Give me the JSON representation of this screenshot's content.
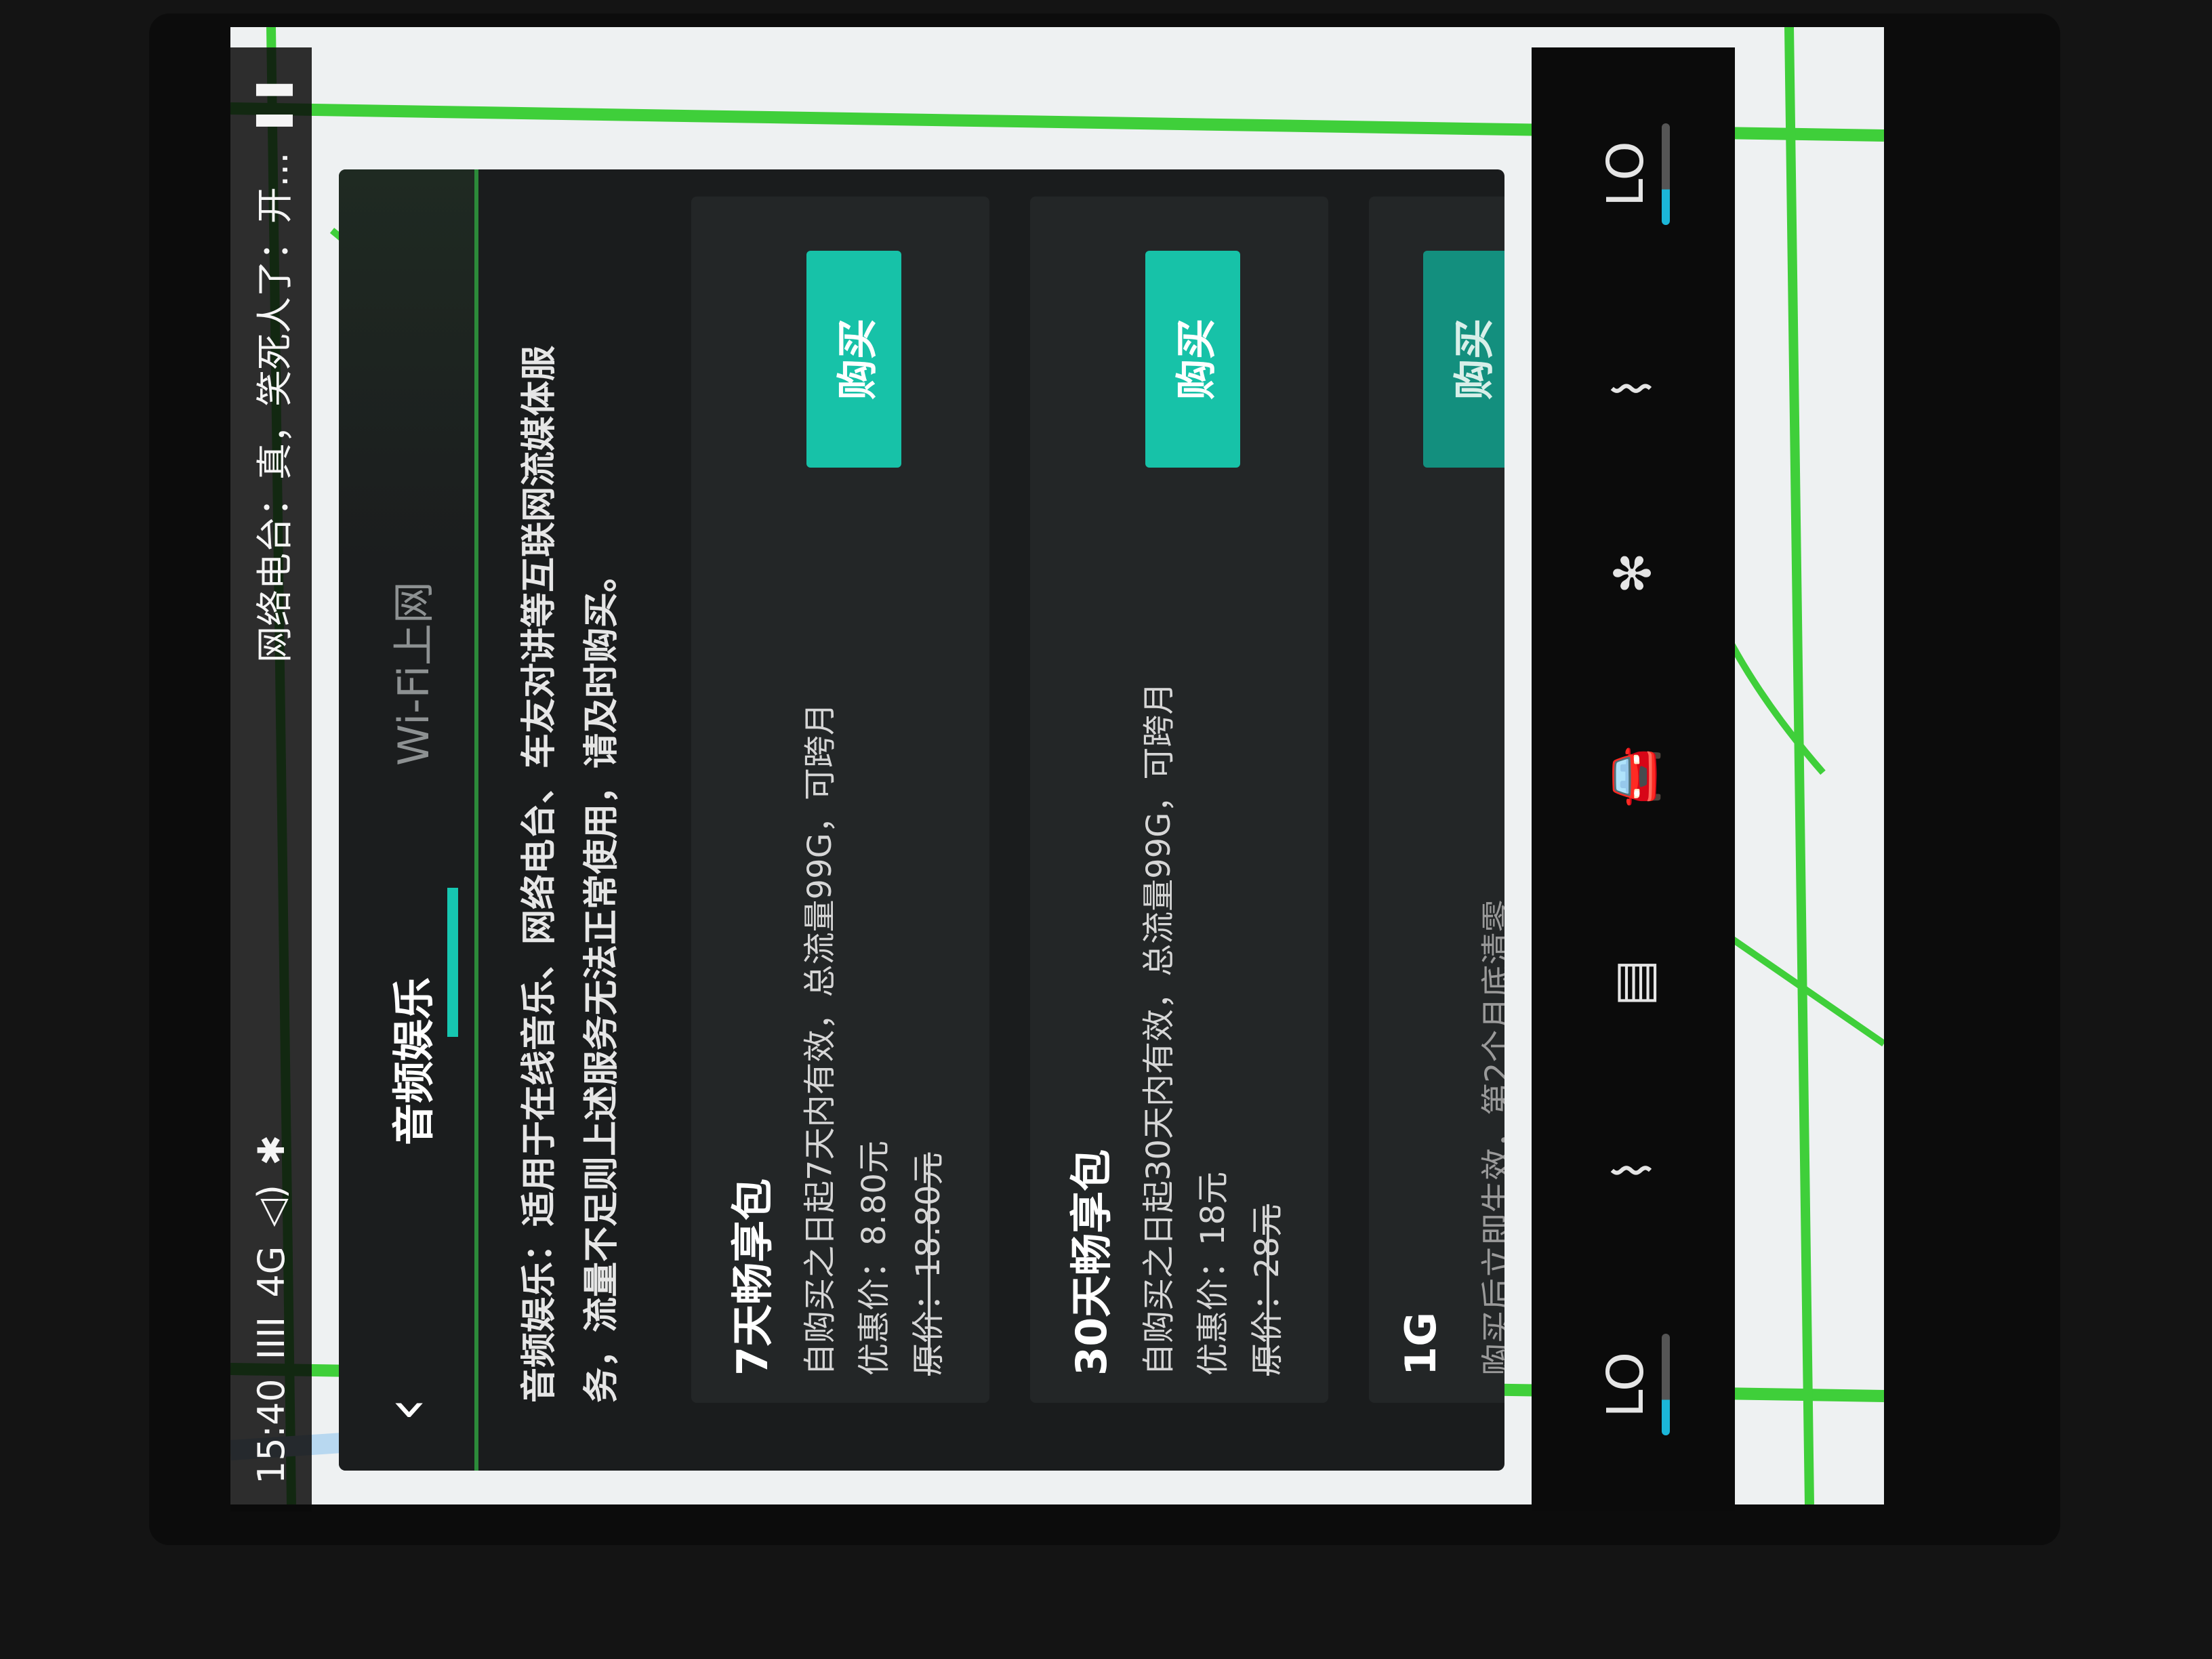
{
  "status": {
    "time": "15:40",
    "signal": "IIII",
    "network": "4G",
    "volume_icon": "speaker-icon",
    "bluetooth_icon": "bluetooth-icon",
    "radio_text": "网络电台：真，笑死人了：开...",
    "pause_icon": "pause-icon"
  },
  "header": {
    "back_icon": "back-chevron-icon",
    "tabs": [
      {
        "label": "音频娱乐",
        "active": true
      },
      {
        "label": "Wi-Fi上网",
        "active": false
      }
    ]
  },
  "description": {
    "line1": "音频娱乐：适用于在线音乐、网络电台、车友对讲等互联网流媒体服",
    "line2": "务，流量不足则上述服务无法正常使用，请及时购买。"
  },
  "packages": [
    {
      "title": "7天畅享包",
      "line1": "自购买之日起7天内有效，总流量99G，可跨月",
      "discount": "优惠价：8.80元",
      "original": "原价：18.80元",
      "button": "购买"
    },
    {
      "title": "30天畅享包",
      "line1": "自购买之日起30天内有效，总流量99G，可跨月",
      "discount": "优惠价：18元",
      "original": "原价：28元",
      "button": "购买"
    },
    {
      "title": "1G",
      "line1": "购买后立即生效，第2个月底清零",
      "button": "购买"
    }
  ],
  "bottom_bar": {
    "left_temp": "LO",
    "right_temp": "LO",
    "icons": [
      "seat-heat-left-icon",
      "media-icon",
      "car-icon",
      "fan-icon",
      "seat-heat-right-icon"
    ]
  },
  "colors": {
    "accent": "#17c2a8",
    "panel": "#1a1c1d",
    "card": "#232627",
    "map_road": "#3fcf3a"
  }
}
